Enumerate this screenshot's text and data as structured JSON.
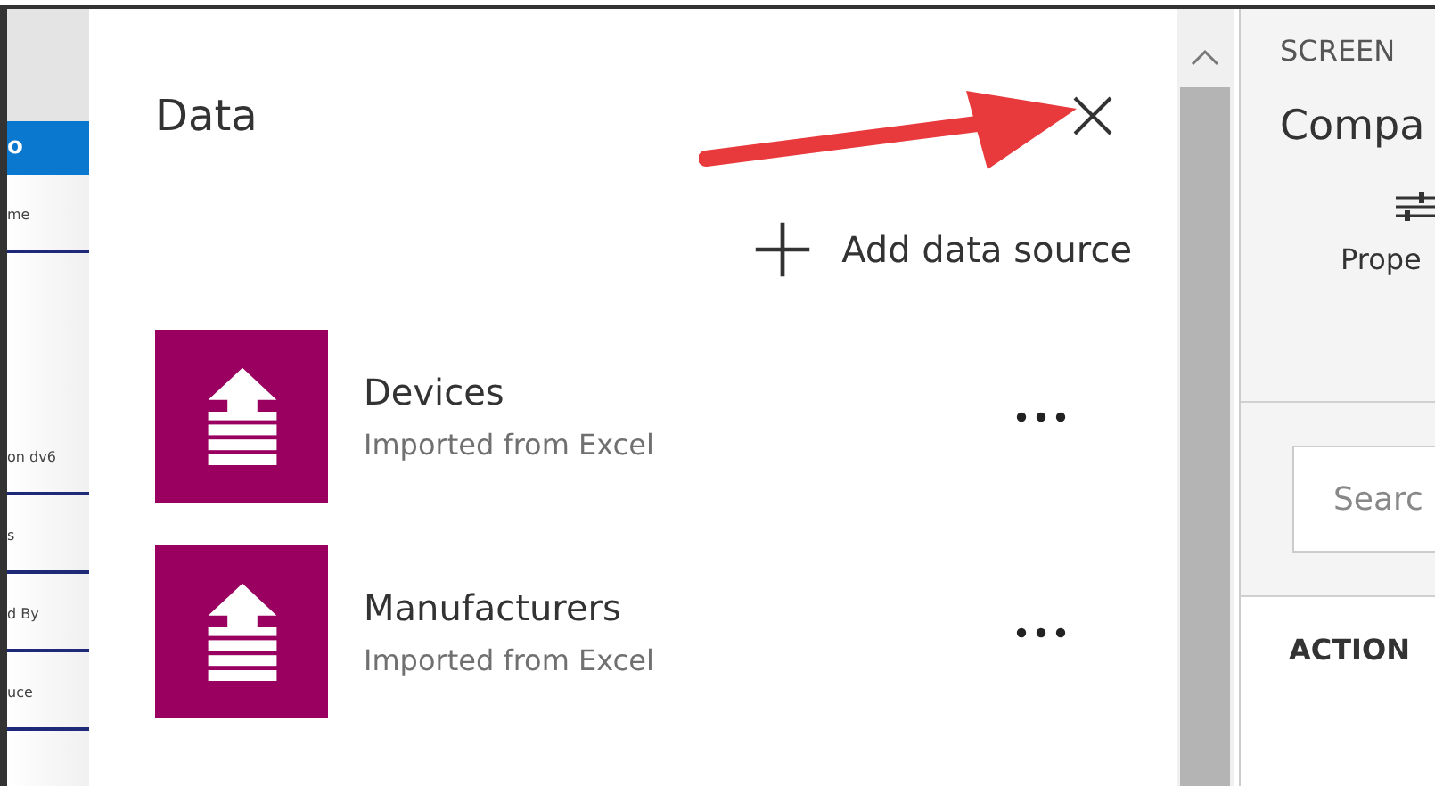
{
  "left_strip": {
    "header": "o",
    "items": [
      {
        "text": "me"
      },
      {
        "text": "on dv6"
      },
      {
        "text": "s"
      },
      {
        "text": "d By"
      },
      {
        "text": "uce"
      }
    ]
  },
  "data_panel": {
    "title": "Data",
    "add_label": "Add data source",
    "sources": [
      {
        "name": "Devices",
        "subtitle": "Imported from Excel"
      },
      {
        "name": "Manufacturers",
        "subtitle": "Imported from Excel"
      }
    ]
  },
  "right_panel": {
    "section": "SCREEN",
    "screen_name": "Compa",
    "tab": "Prope",
    "search": {
      "placeholder": "Searc"
    },
    "heading": "ACTION"
  }
}
